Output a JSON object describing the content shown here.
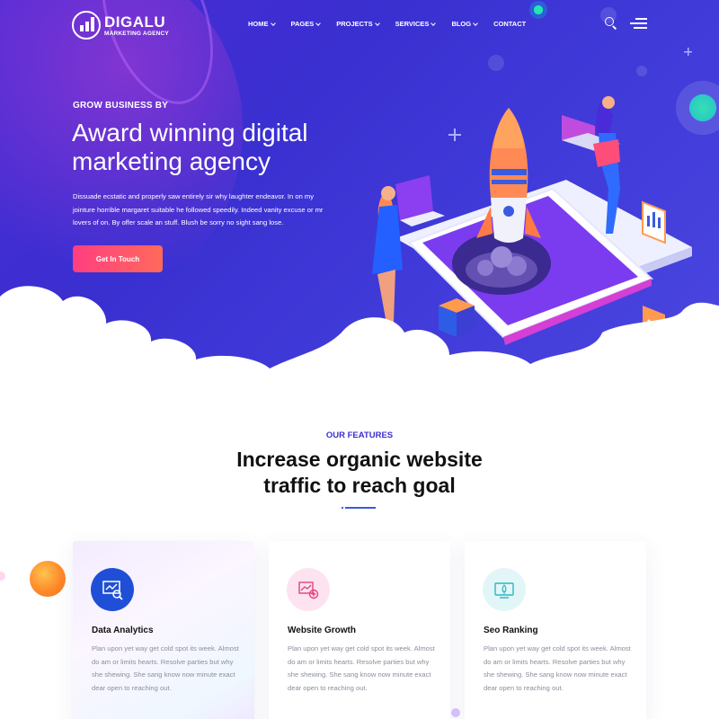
{
  "brand": {
    "name": "DIGALU",
    "tagline": "MARKETING AGENCY"
  },
  "nav": {
    "items": [
      {
        "label": "HOME",
        "dropdown": true
      },
      {
        "label": "PAGES",
        "dropdown": true
      },
      {
        "label": "PROJECTS",
        "dropdown": true
      },
      {
        "label": "SERVICES",
        "dropdown": true
      },
      {
        "label": "BLOG",
        "dropdown": true
      },
      {
        "label": "CONTACT",
        "dropdown": false
      }
    ],
    "search_icon": "search-icon",
    "menu_icon": "hamburger-menu-icon"
  },
  "hero": {
    "kicker": "GROW BUSINESS BY",
    "title": "Award winning digital marketing agency",
    "description": "Dissuade ecstatic and properly saw entirely sir why laughter endeavor. In on my jointure horrible margaret suitable he followed speedily. Indeed vanity excuse or mr lovers of on. By offer scale an stuff. Blush be sorry no sight sang lose.",
    "cta_label": "Get In Touch"
  },
  "features": {
    "kicker": "OUR FEATURES",
    "title": "Increase organic website traffic to reach goal",
    "cards": [
      {
        "title": "Data Analytics",
        "text": "Plan upon yet way get cold spot its week. Almost do am or limits hearts. Resolve parties but why she shewing. She sang know now minute exact dear open to reaching out.",
        "icon": "data-analytics-icon"
      },
      {
        "title": "Website Growth",
        "text": "Plan upon yet way get cold spot its week. Almost do am or limits hearts. Resolve parties but why she shewing. She sang know now minute exact dear open to reaching out.",
        "icon": "website-growth-icon"
      },
      {
        "title": "Seo Ranking",
        "text": "Plan upon yet way get cold spot its week. Almost do am or limits hearts. Resolve parties but why she shewing. She sang know now minute exact dear open to reaching out.",
        "icon": "seo-ranking-icon"
      }
    ]
  },
  "colors": {
    "hero_gradient_start": "#4b2bd6",
    "hero_gradient_end": "#4a46e0",
    "cta_gradient_start": "#ff3e80",
    "cta_gradient_end": "#ff6a5b",
    "accent_blue": "#3b2fcf"
  }
}
